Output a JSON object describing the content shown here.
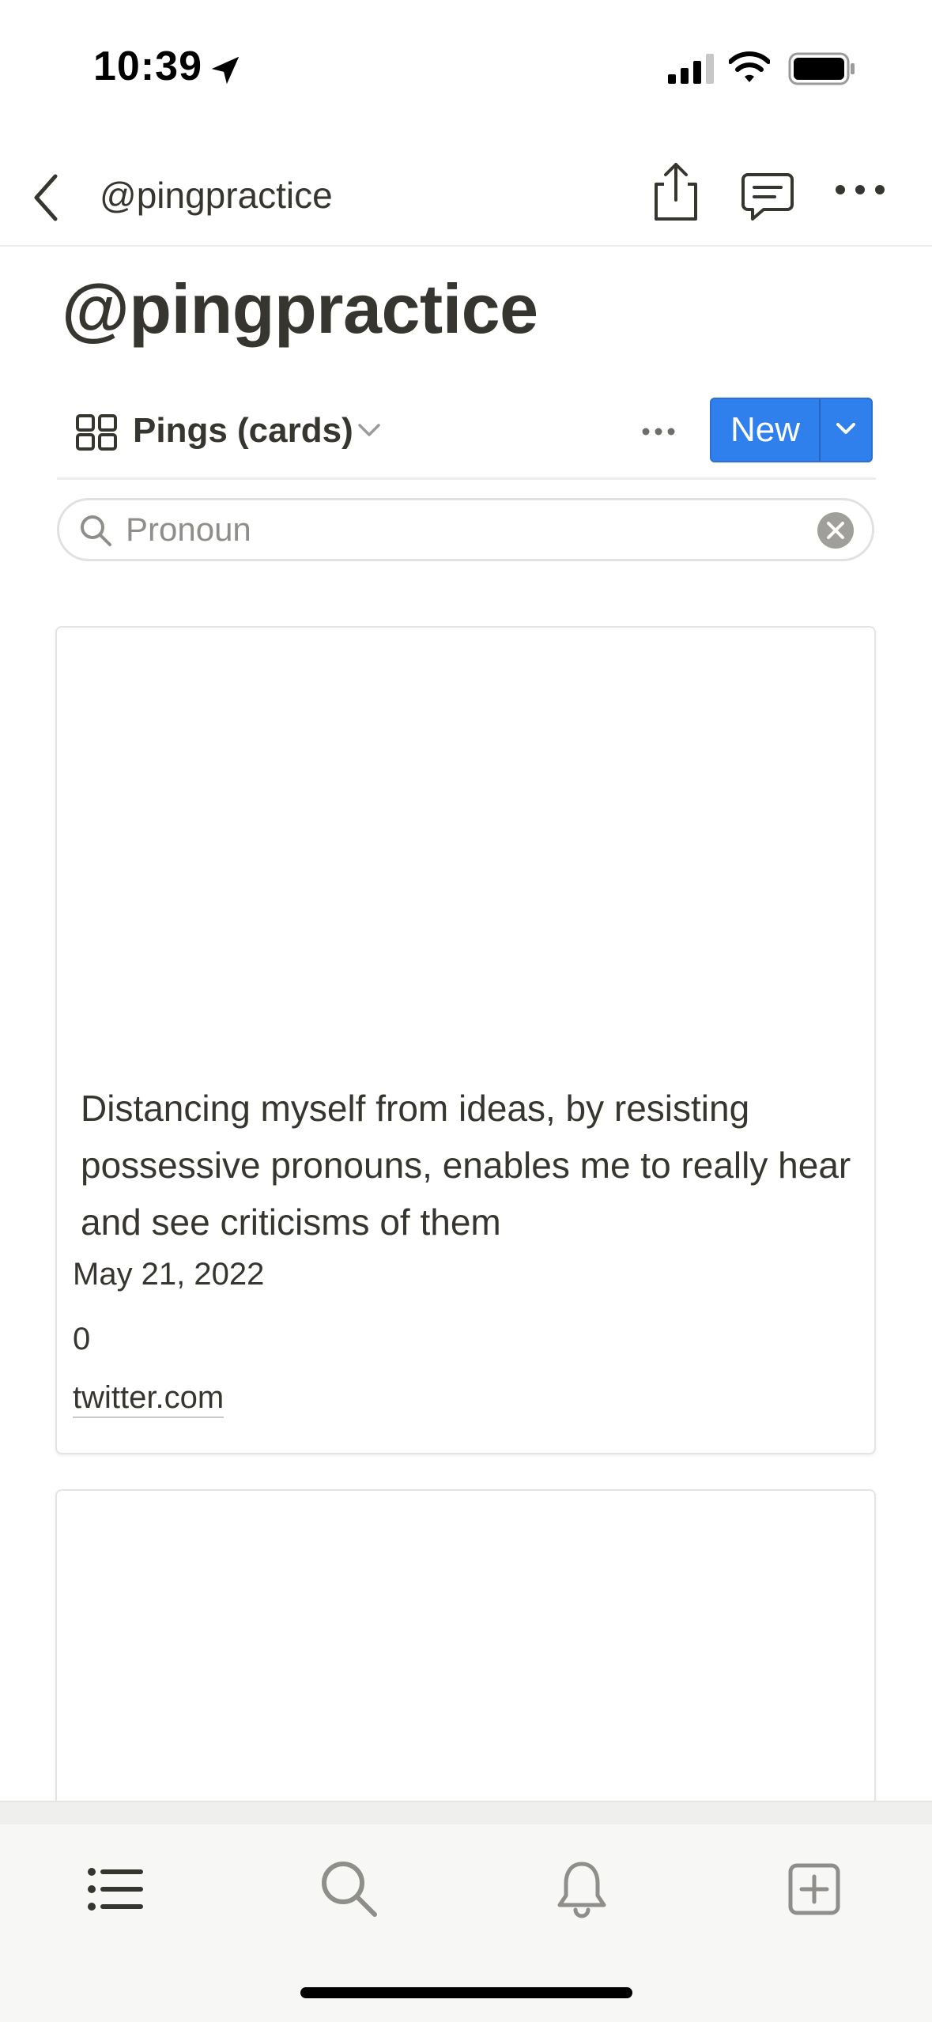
{
  "status_bar": {
    "time": "10:39",
    "icons": [
      "location-arrow-icon",
      "cellular-signal-icon",
      "wifi-icon",
      "battery-icon"
    ]
  },
  "nav": {
    "title": "@pingpractice",
    "icons": [
      "back-chevron-icon",
      "share-icon",
      "comment-icon",
      "more-horizontal-icon"
    ]
  },
  "page": {
    "title": "@pingpractice"
  },
  "view": {
    "label": "Pings (cards)",
    "new_label": "New"
  },
  "search": {
    "value": "Pronoun",
    "placeholder": ""
  },
  "cards": [
    {
      "title": "Distancing myself from ideas, by resisting possessive pronouns, enables me to really hear and see criticisms of them",
      "date": "May 21, 2022",
      "count": "0",
      "link": "twitter.com"
    }
  ],
  "tab_bar": {
    "items": [
      "list-icon",
      "search-icon",
      "bell-icon",
      "add-page-icon"
    ]
  },
  "colors": {
    "accent": "#2f80ed",
    "text": "#37352f",
    "muted": "#8f8e8a",
    "border": "#e4e4e2"
  }
}
